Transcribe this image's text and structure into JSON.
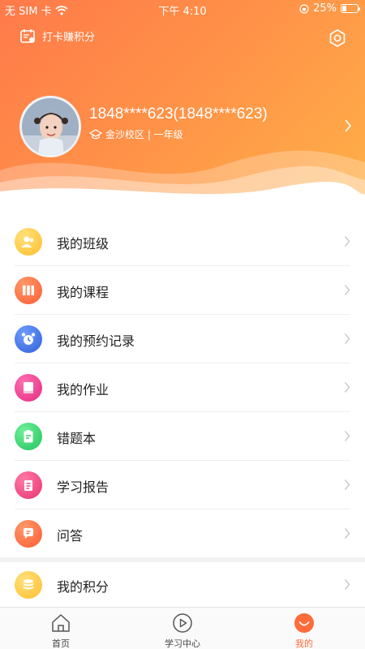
{
  "status_bar": {
    "carrier": "无 SIM 卡",
    "time": "下午 4:10",
    "battery": "25%"
  },
  "header": {
    "checkin_label": "打卡赚积分"
  },
  "profile": {
    "username": "1848****623(1848****623)",
    "school": "金沙校区 | 一年级"
  },
  "menu": {
    "items": [
      {
        "label": "我的班级",
        "icon": "class-icon",
        "color": "#ffc43a"
      },
      {
        "label": "我的课程",
        "icon": "course-books-icon",
        "color": "#ff6a3c"
      },
      {
        "label": "我的预约记录",
        "icon": "alarm-clock-icon",
        "color": "#3d6fe0"
      },
      {
        "label": "我的作业",
        "icon": "homework-book-icon",
        "color": "#f0388e"
      },
      {
        "label": "错题本",
        "icon": "clipboard-icon",
        "color": "#2fcf6a"
      },
      {
        "label": "学习报告",
        "icon": "report-icon",
        "color": "#f0447f"
      },
      {
        "label": "问答",
        "icon": "chat-bubble-icon",
        "color": "#ff6a3c"
      }
    ]
  },
  "points": {
    "label": "我的积分",
    "icon": "coins-stack-icon",
    "color": "#ffc43a"
  },
  "tabbar": {
    "tabs": [
      {
        "label": "首页",
        "icon": "home-icon",
        "active": false
      },
      {
        "label": "学习中心",
        "icon": "play-circle-icon",
        "active": false
      },
      {
        "label": "我的",
        "icon": "smile-icon",
        "active": true
      }
    ],
    "active_color": "#ff6b3a"
  },
  "colors": {
    "header_gradient_start": "#ff7a4a",
    "header_gradient_end": "#ffb048"
  }
}
